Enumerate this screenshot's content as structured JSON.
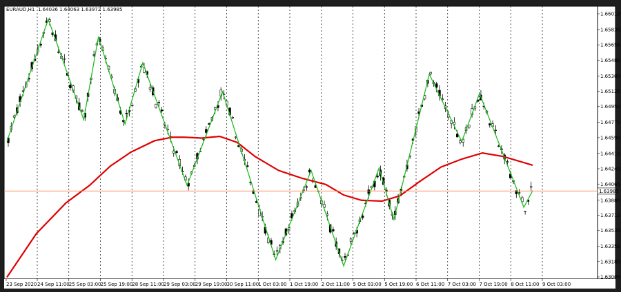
{
  "header": {
    "symbol": "EURAUD,H1",
    "ohlc": "1.64036 1.64063 1.63972 1.63985"
  },
  "price_tag": "1.63985",
  "colors": {
    "background": "#ffffff",
    "frame": "#1e1e1e",
    "candles": "#000000",
    "ma_line": "#e00000",
    "zigzag": "#22bb22",
    "price_line": "#ff8c5a",
    "grid": "#000000"
  },
  "chart_data": {
    "type": "line",
    "symbol": "EURAUD",
    "timeframe": "H1",
    "ylim": [
      1.63005,
      1.6601
    ],
    "y_ticks": [
      "1.66010",
      "1.65830",
      "1.65655",
      "1.65480",
      "1.65300",
      "1.65125",
      "1.64950",
      "1.64770",
      "1.64595",
      "1.64415",
      "1.64240",
      "1.64065",
      "1.63880",
      "1.63710",
      "1.63535",
      "1.63355",
      "1.63180",
      "1.63005"
    ],
    "x_ticks": [
      "23 Sep 2020",
      "24 Sep 11:00",
      "25 Sep 03:00",
      "25 Sep 19:00",
      "28 Sep 11:00",
      "29 Sep 03:00",
      "29 Sep 19:00",
      "30 Sep 11:00",
      "1 Oct 03:00",
      "1 Oct 19:00",
      "2 Oct 11:00",
      "5 Oct 03:00",
      "5 Oct 19:00",
      "6 Oct 11:00",
      "7 Oct 03:00",
      "7 Oct 19:00",
      "8 Oct 11:00",
      "9 Oct 03:00"
    ],
    "bar_count": 178,
    "current_price": 1.63985,
    "grid": "vertical dotted",
    "series": [
      {
        "kind": "zigzag",
        "points": [
          {
            "bar": 0,
            "price": 1.6455
          },
          {
            "bar": 14,
            "price": 1.6595
          },
          {
            "bar": 26,
            "price": 1.648
          },
          {
            "bar": 31,
            "price": 1.6575
          },
          {
            "bar": 40,
            "price": 1.6475
          },
          {
            "bar": 46,
            "price": 1.6545
          },
          {
            "bar": 61,
            "price": 1.6405
          },
          {
            "bar": 73,
            "price": 1.6512
          },
          {
            "bar": 91,
            "price": 1.632
          },
          {
            "bar": 103,
            "price": 1.6422
          },
          {
            "bar": 114,
            "price": 1.6313
          },
          {
            "bar": 126,
            "price": 1.6425
          },
          {
            "bar": 131,
            "price": 1.6366
          },
          {
            "bar": 143,
            "price": 1.6532
          },
          {
            "bar": 154,
            "price": 1.6455
          },
          {
            "bar": 160,
            "price": 1.651
          },
          {
            "bar": 175,
            "price": 1.638
          },
          {
            "bar": 178,
            "price": 1.6399
          }
        ]
      },
      {
        "kind": "moving_average",
        "points": [
          {
            "bar": 0,
            "price": 1.63
          },
          {
            "bar": 10,
            "price": 1.635
          },
          {
            "bar": 20,
            "price": 1.6385
          },
          {
            "bar": 28,
            "price": 1.6405
          },
          {
            "bar": 35,
            "price": 1.6427
          },
          {
            "bar": 42,
            "price": 1.6443
          },
          {
            "bar": 50,
            "price": 1.6456
          },
          {
            "bar": 56,
            "price": 1.646
          },
          {
            "bar": 60,
            "price": 1.646
          },
          {
            "bar": 66,
            "price": 1.6459
          },
          {
            "bar": 72,
            "price": 1.6461
          },
          {
            "bar": 78,
            "price": 1.6454
          },
          {
            "bar": 84,
            "price": 1.6438
          },
          {
            "bar": 92,
            "price": 1.6422
          },
          {
            "bar": 100,
            "price": 1.6413
          },
          {
            "bar": 108,
            "price": 1.6406
          },
          {
            "bar": 114,
            "price": 1.6394
          },
          {
            "bar": 120,
            "price": 1.6388
          },
          {
            "bar": 127,
            "price": 1.6387
          },
          {
            "bar": 133,
            "price": 1.6393
          },
          {
            "bar": 140,
            "price": 1.641
          },
          {
            "bar": 147,
            "price": 1.6426
          },
          {
            "bar": 154,
            "price": 1.6435
          },
          {
            "bar": 161,
            "price": 1.6442
          },
          {
            "bar": 168,
            "price": 1.6438
          },
          {
            "bar": 178,
            "price": 1.6428
          }
        ]
      }
    ]
  }
}
